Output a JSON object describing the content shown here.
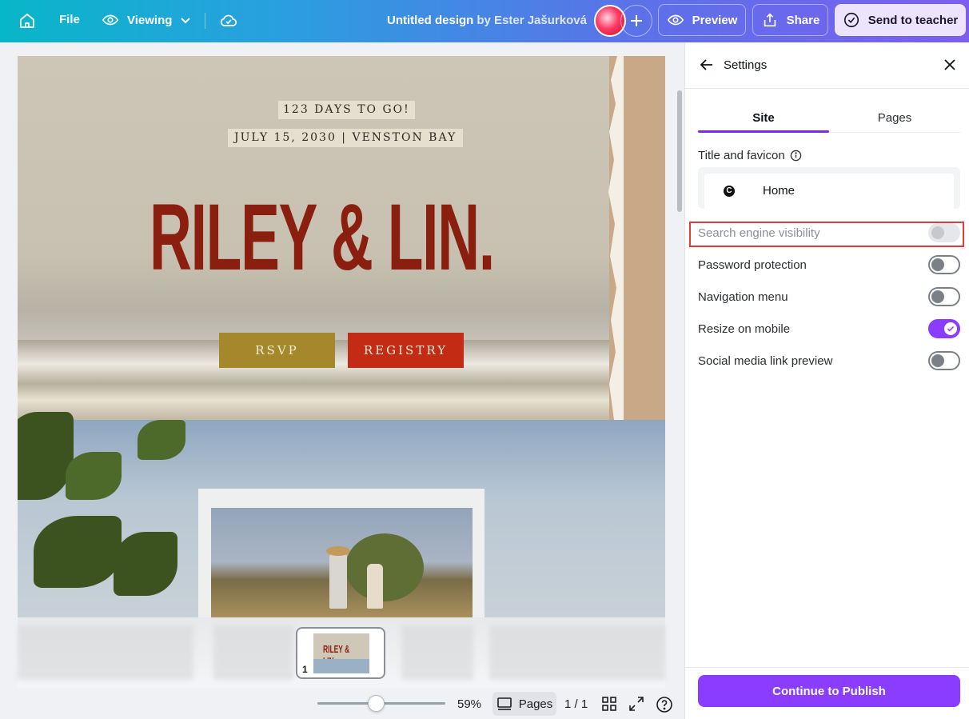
{
  "topbar": {
    "file_label": "File",
    "viewing_label": "Viewing",
    "doc_title": "Untitled design",
    "doc_owner": "by Ester Jašurková",
    "preview_label": "Preview",
    "share_label": "Share",
    "send_label": "Send to teacher",
    "icons": [
      "home-icon",
      "eye-icon",
      "chevron-down-icon",
      "cloud-check-icon",
      "plus-icon",
      "share-upload-icon",
      "check-circle-icon"
    ],
    "gradient_start": "#08b6c9",
    "gradient_end": "#7b5ef0"
  },
  "design": {
    "countdown": "123 DAYS TO GO!",
    "date_location": "JULY 15, 2030 | VENSTON BAY",
    "couple_title": "RILEY & LIN.",
    "rsvp_label": "RSVP",
    "registry_label": "REGISTRY",
    "title_color": "#8a1f10",
    "rsvp_color": "#a5872c",
    "registry_color": "#c32b14"
  },
  "thumbnails": {
    "page_number": "1",
    "mini_title": "RILEY & LIN."
  },
  "bottom_bar": {
    "zoom": "59%",
    "zoom_value": 59,
    "pages_label": "Pages",
    "page_count": "1 / 1"
  },
  "panel": {
    "title": "Settings",
    "tabs": [
      {
        "label": "Site",
        "active": true
      },
      {
        "label": "Pages",
        "active": false
      }
    ],
    "favicon_section_label": "Title and favicon",
    "favicon_logo_letter": "C",
    "favicon_title": "Home",
    "settings": [
      {
        "label": "Search engine visibility",
        "on": false,
        "disabled": true
      },
      {
        "label": "Password protection",
        "on": false,
        "disabled": false
      },
      {
        "label": "Navigation menu",
        "on": false,
        "disabled": false
      },
      {
        "label": "Resize on mobile",
        "on": true,
        "disabled": false
      },
      {
        "label": "Social media link preview",
        "on": false,
        "disabled": false
      }
    ],
    "publish_label": "Continue to Publish",
    "accent": "#8b3dff"
  }
}
